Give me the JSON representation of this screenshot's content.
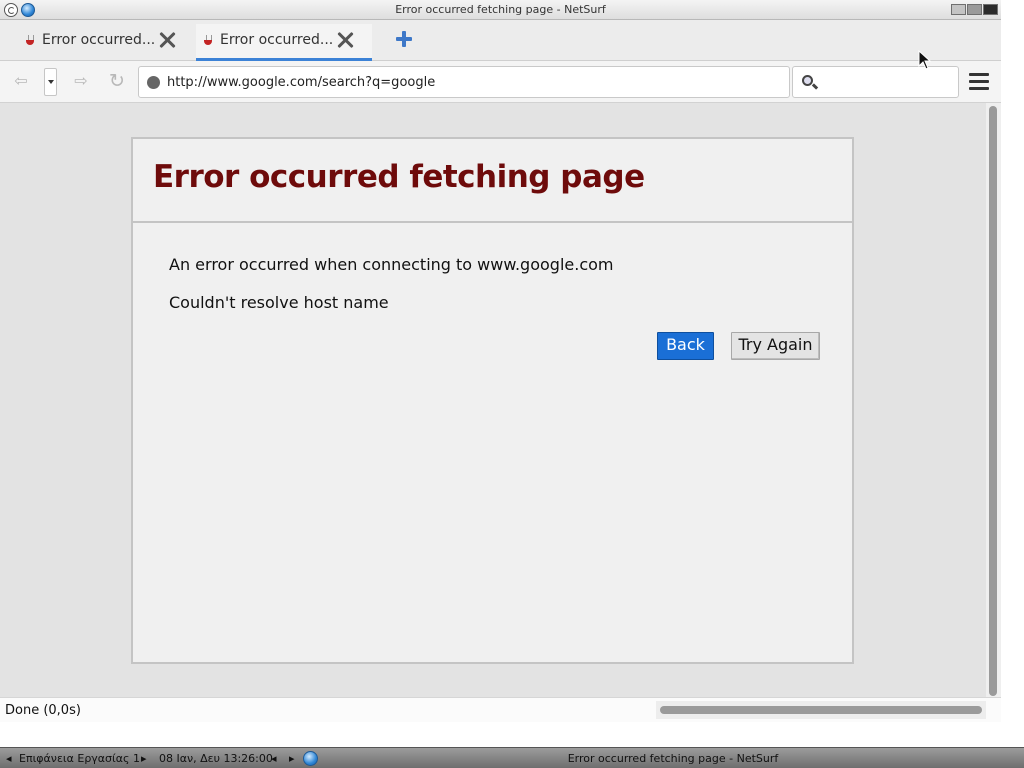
{
  "window": {
    "title": "Error occurred fetching page - NetSurf",
    "icons": [
      "debian-icon",
      "globe-icon",
      "minimize-icon",
      "maximize-icon",
      "close-icon"
    ]
  },
  "tabs": [
    {
      "label": "Error occurred...",
      "active": false
    },
    {
      "label": "Error occurred...",
      "active": true
    }
  ],
  "toolbar": {
    "back_glyph": "⇦",
    "forward_glyph": "⇨",
    "reload_glyph": "↻",
    "url": "http://www.google.com/search?q=google",
    "search_value": ""
  },
  "page": {
    "title": "Error occurred fetching page",
    "message": "An error occurred when connecting to www.google.com",
    "detail": "Couldn't resolve host name",
    "back_label": "Back",
    "try_again_label": "Try Again"
  },
  "status": {
    "text": "Done (0,0s)"
  },
  "taskbar": {
    "prev_glyph": "◂",
    "next_glyph": "▸",
    "desktop": "Επιφάνεια Εργασίας 1",
    "clock": "08 Ιαν, Δευ 13:26:00",
    "window_title": "Error occurred fetching page - NetSurf"
  },
  "colors": {
    "error_title": "#6e0b0b",
    "primary_button": "#1a6fd6",
    "active_tab_underline": "#3c82d6",
    "new_tab_plus": "#3e78c8"
  }
}
